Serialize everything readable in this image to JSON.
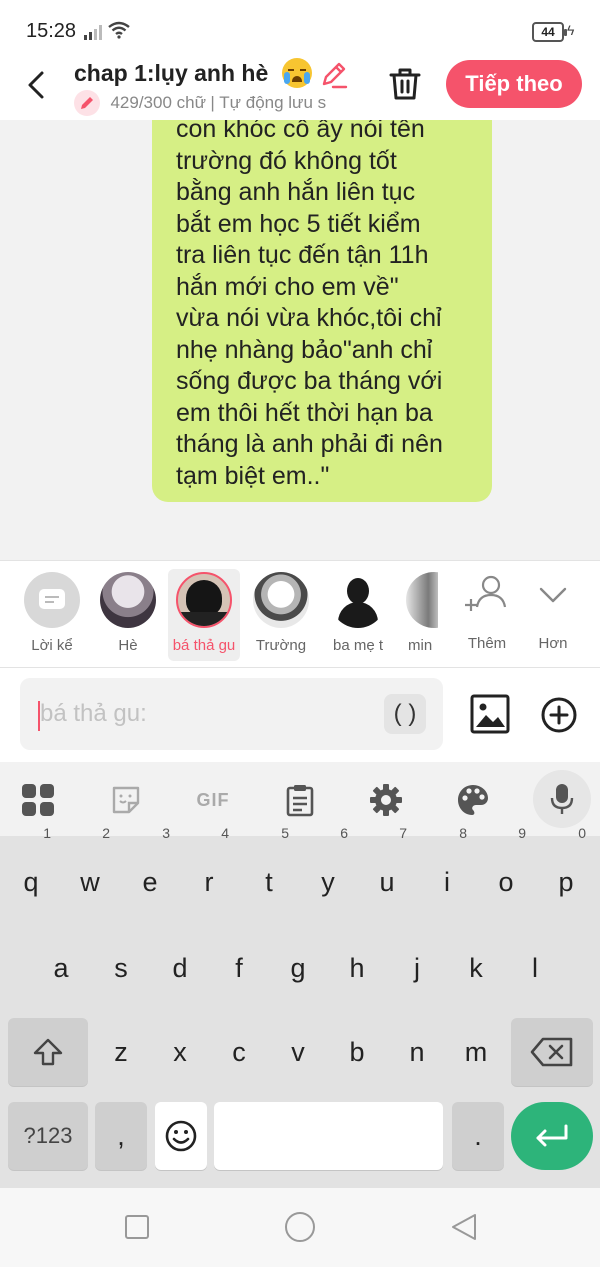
{
  "status_bar": {
    "time": "15:28",
    "battery": "44"
  },
  "header": {
    "title": "chap 1:lụy anh hè",
    "title_emoji": "crying-face-icon",
    "word_count": "429/300 chữ",
    "autosave": "| Tự động lưu s",
    "next_label": "Tiếp theo",
    "accent_color": "#f5536b"
  },
  "bubble": {
    "color": "#d6ef85",
    "text": "con khóc cô ấy nói tên\ntrường đó không tốt\nbằng anh hắn liên tục\nbắt em học 5 tiết kiểm\ntra liên tục đến tận 11h\nhắn mới cho em về\"\nvừa nói vừa khóc,tôi chỉ\nnhẹ nhàng bảo\"anh chỉ\nsống được ba tháng với\nem thôi hết thời hạn ba\ntháng là anh phải đi nên\ntạm biệt em..\""
  },
  "characters": [
    {
      "label": "Lời kể"
    },
    {
      "label": "Hè"
    },
    {
      "label": "bá thả gu"
    },
    {
      "label": "Trường"
    },
    {
      "label": "ba mẹ t"
    },
    {
      "label": "min"
    }
  ],
  "char_actions": {
    "add_label": "Thêm",
    "more_label": "Hơn"
  },
  "composer": {
    "placeholder": "bá thả gu:",
    "value": "",
    "paren_label": "( )"
  },
  "keyboard": {
    "row1": [
      {
        "key": "q",
        "num": "1"
      },
      {
        "key": "w",
        "num": "2"
      },
      {
        "key": "e",
        "num": "3"
      },
      {
        "key": "r",
        "num": "4"
      },
      {
        "key": "t",
        "num": "5"
      },
      {
        "key": "y",
        "num": "6"
      },
      {
        "key": "u",
        "num": "7"
      },
      {
        "key": "i",
        "num": "8"
      },
      {
        "key": "o",
        "num": "9"
      },
      {
        "key": "p",
        "num": "0"
      }
    ],
    "row2": [
      "a",
      "s",
      "d",
      "f",
      "g",
      "h",
      "j",
      "k",
      "l"
    ],
    "row3": [
      "z",
      "x",
      "c",
      "v",
      "b",
      "n",
      "m"
    ],
    "sym_label": "?123",
    "comma_label": ",",
    "period_label": ".",
    "gif_label": "GIF",
    "enter_color": "#2db47a"
  }
}
